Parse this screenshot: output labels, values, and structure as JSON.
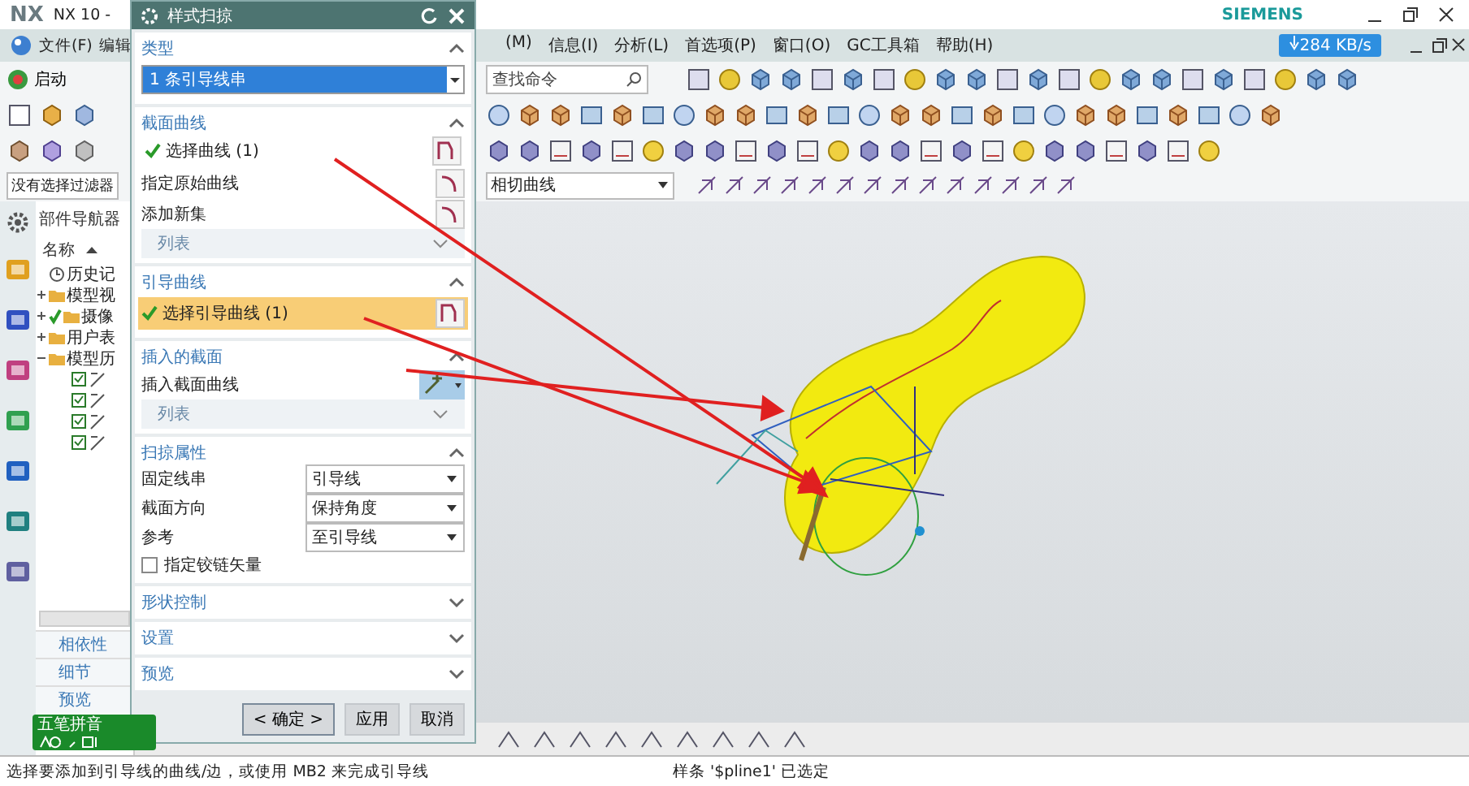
{
  "title_bar": {
    "logo": "NX",
    "title": "NX 10 -",
    "brand": "SIEMENS"
  },
  "menu_bar": {
    "items_left": [
      "文件(F)",
      "编辑"
    ],
    "items_right": [
      "(M)",
      "信息(I)",
      "分析(L)",
      "首选项(P)",
      "窗口(O)",
      "GC工具箱",
      "帮助(H)"
    ],
    "speed": "284 KB/s"
  },
  "toolbar": {
    "start_button": "启动",
    "search_placeholder": "查找命令",
    "selection_filter": "没有选择过滤器",
    "curve_rule": "相切曲线"
  },
  "navigator": {
    "title": "部件导航器",
    "column": "名称",
    "tree": [
      {
        "label": "历史记",
        "kind": "leaf",
        "checked": false
      },
      {
        "label": "模型视",
        "kind": "folder",
        "expanded": false,
        "checked": false
      },
      {
        "label": "摄像",
        "kind": "folder",
        "expanded": false,
        "checked": true
      },
      {
        "label": "用户表",
        "kind": "folder",
        "expanded": false,
        "checked": false
      },
      {
        "label": "模型历",
        "kind": "folder",
        "expanded": true,
        "checked": false,
        "children": [
          {
            "checked": true
          },
          {
            "checked": true
          },
          {
            "checked": true
          },
          {
            "checked": true
          }
        ]
      }
    ],
    "panels": [
      "相依性",
      "细节",
      "预览"
    ]
  },
  "dialog": {
    "title": "样式扫掠",
    "sections": [
      {
        "title": "类型",
        "expanded": true,
        "rows": [
          {
            "kind": "dropdown",
            "value": "1 条引导线串"
          }
        ]
      },
      {
        "title": "截面曲线",
        "expanded": true,
        "rows": [
          {
            "kind": "select",
            "label": "选择曲线 (1)",
            "done": true,
            "highlighted": false
          },
          {
            "kind": "label",
            "label": "指定原始曲线"
          },
          {
            "kind": "label",
            "label": "添加新集"
          },
          {
            "kind": "list",
            "label": "列表"
          }
        ]
      },
      {
        "title": "引导曲线",
        "expanded": true,
        "rows": [
          {
            "kind": "select",
            "label": "选择引导曲线 (1)",
            "done": true,
            "highlighted": true
          }
        ]
      },
      {
        "title": "插入的截面",
        "expanded": true,
        "rows": [
          {
            "kind": "tool",
            "label": "插入截面曲线"
          },
          {
            "kind": "list",
            "label": "列表"
          }
        ]
      },
      {
        "title": "扫掠属性",
        "expanded": true,
        "rows": [
          {
            "kind": "field",
            "label": "固定线串",
            "value": "引导线"
          },
          {
            "kind": "field",
            "label": "截面方向",
            "value": "保持角度"
          },
          {
            "kind": "field",
            "label": "参考",
            "value": "至引导线"
          },
          {
            "kind": "checkbox",
            "label": "指定铰链矢量",
            "checked": false
          }
        ]
      },
      {
        "title": "形状控制",
        "expanded": false
      },
      {
        "title": "设置",
        "expanded": false
      },
      {
        "title": "预览",
        "expanded": false
      }
    ],
    "buttons": [
      {
        "label": "< 确定 >",
        "default": true
      },
      {
        "label": "应用",
        "default": false
      },
      {
        "label": "取消",
        "default": false
      }
    ]
  },
  "ime": {
    "label": "五笔拼音"
  },
  "status_bar": {
    "prompt": "选择要添加到引导线的曲线/边，或使用 MB2 来完成引导线",
    "message": "样条 '$pline1' 已选定"
  }
}
